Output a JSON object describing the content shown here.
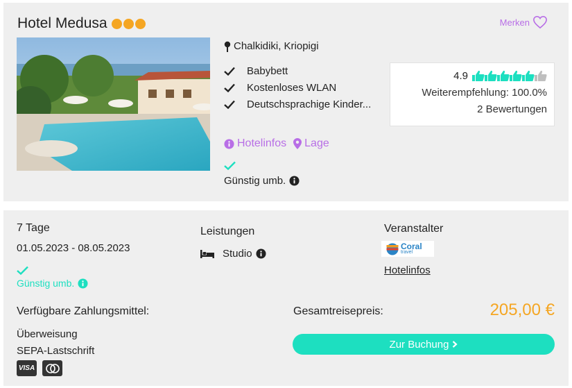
{
  "hotel": {
    "name": "Hotel Medusa",
    "stars": 3,
    "merken_label": "Merken",
    "location": "Chalkidiki, Kriopigi",
    "features": [
      "Babybett",
      "Kostenloses WLAN",
      "Deutschsprachige Kinder..."
    ],
    "rating": {
      "score": "4.9",
      "thumbs_max": 6,
      "thumbs_value": 4.9,
      "recommendation": "Weiterempfehlung: 100.0%",
      "reviews": "2 Bewertungen"
    },
    "links": {
      "hotelinfos": "Hotelinfos",
      "lage": "Lage"
    },
    "price_note": "Günstig umb."
  },
  "offer": {
    "duration": "7 Tage",
    "dates": "01.05.2023 - 08.05.2023",
    "price_note": "Günstig umb.",
    "leistungen_heading": "Leistungen",
    "room": "Studio",
    "veranstalter_heading": "Veranstalter",
    "operator_logo": {
      "name": "Coral",
      "sub": "travel"
    },
    "operator_link": "Hotelinfos",
    "payment_heading": "Verfügbare Zahlungsmittel:",
    "payment_methods": [
      "Überweisung",
      "SEPA-Lastschrift"
    ],
    "payment_icons": [
      "visa-icon",
      "mastercard-icon"
    ],
    "visa_label": "VISA",
    "total_heading": "Gesamtreisepreis:",
    "total_price": "205,00 €",
    "book_label": "Zur Buchung"
  },
  "colors": {
    "accent_purple": "#b86ee6",
    "accent_teal": "#1ddfc0",
    "price_orange": "#f5a623",
    "card_bg": "#efefef"
  }
}
